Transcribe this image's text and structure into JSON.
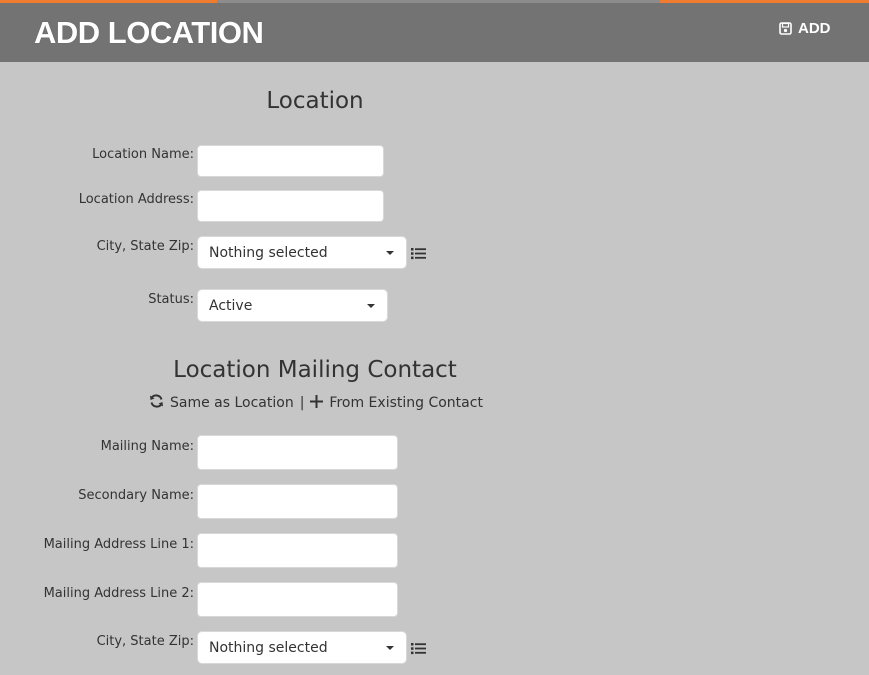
{
  "header": {
    "title": "ADD LOCATION",
    "add_button": {
      "label": "ADD",
      "icon": "save-icon"
    },
    "accent_color": "#f07c30"
  },
  "location_section": {
    "title": "Location",
    "fields": {
      "location_name": {
        "label": "Location Name:",
        "value": ""
      },
      "location_address": {
        "label": "Location Address:",
        "value": ""
      },
      "city_state_zip": {
        "label": "City, State Zip:",
        "selected": "Nothing selected",
        "icon": "list-icon"
      },
      "status": {
        "label": "Status:",
        "selected": "Active"
      }
    }
  },
  "mailing_section": {
    "title": "Location Mailing Contact",
    "actions": {
      "same_as_location": {
        "label": "Same as Location",
        "icon": "refresh-icon"
      },
      "separator": "|",
      "from_existing": {
        "label": "From Existing Contact",
        "icon": "plus-icon"
      }
    },
    "fields": {
      "mailing_name": {
        "label": "Mailing Name:",
        "value": ""
      },
      "secondary_name": {
        "label": "Secondary Name:",
        "value": ""
      },
      "address_line_1": {
        "label": "Mailing Address Line 1:",
        "value": ""
      },
      "address_line_2": {
        "label": "Mailing Address Line 2:",
        "value": ""
      },
      "city_state_zip": {
        "label": "City, State Zip:",
        "selected": "Nothing selected",
        "icon": "list-icon"
      }
    }
  }
}
